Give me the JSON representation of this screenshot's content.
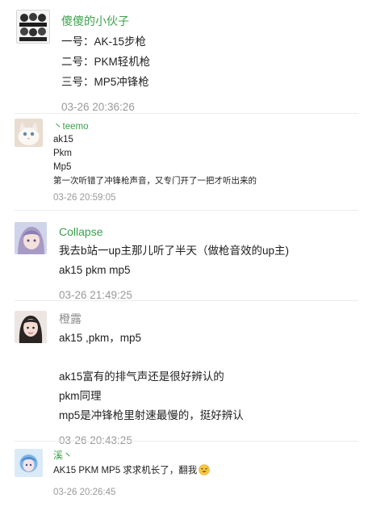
{
  "comments": [
    {
      "username": "傻傻的小伙子",
      "lines": [
        "一号：AK-15步枪",
        "二号：PKM轻机枪",
        "三号：MP5冲锋枪"
      ],
      "timestamp": "03-26 20:36:26",
      "avatar": "cartoon-group-avatar-icon"
    },
    {
      "username": "丶teemo",
      "lines": [
        "ak15",
        "Pkm",
        "Mp5",
        "第一次听错了冲锋枪声音，又专门开了一把才听出来的"
      ],
      "timestamp": "03-26 20:59:05",
      "avatar": "cat-avatar-icon"
    },
    {
      "username": "Collapse",
      "lines": [
        "我去b站一up主那儿听了半天（做枪音效的up主)",
        "ak15 pkm mp5"
      ],
      "timestamp": "03-26 21:49:25",
      "avatar": "anime-girl-avatar-icon"
    },
    {
      "username": "橙露",
      "lines": [
        "ak15 ,pkm，mp5",
        "",
        "ak15富有的排气声还是很好辨认的",
        "pkm同理",
        "mp5是冲锋枪里射速最慢的，挺好辨认"
      ],
      "timestamp": "03-26 20:43:25",
      "avatar": "woman-portrait-avatar-icon"
    },
    {
      "username": "溪丶",
      "lines": [
        "AK15 PKM MP5 求求机长了，翻我"
      ],
      "emoji": "sweat-smile-emoji-icon",
      "timestamp": "03-26 20:26:45",
      "avatar": "anime-character-avatar-icon"
    }
  ],
  "colors": {
    "username_green": "#3aa14a",
    "username_gray": "#8c8c8c",
    "timestamp": "#9a9a9a",
    "text": "#1f1f1f",
    "divider": "#ececec"
  }
}
